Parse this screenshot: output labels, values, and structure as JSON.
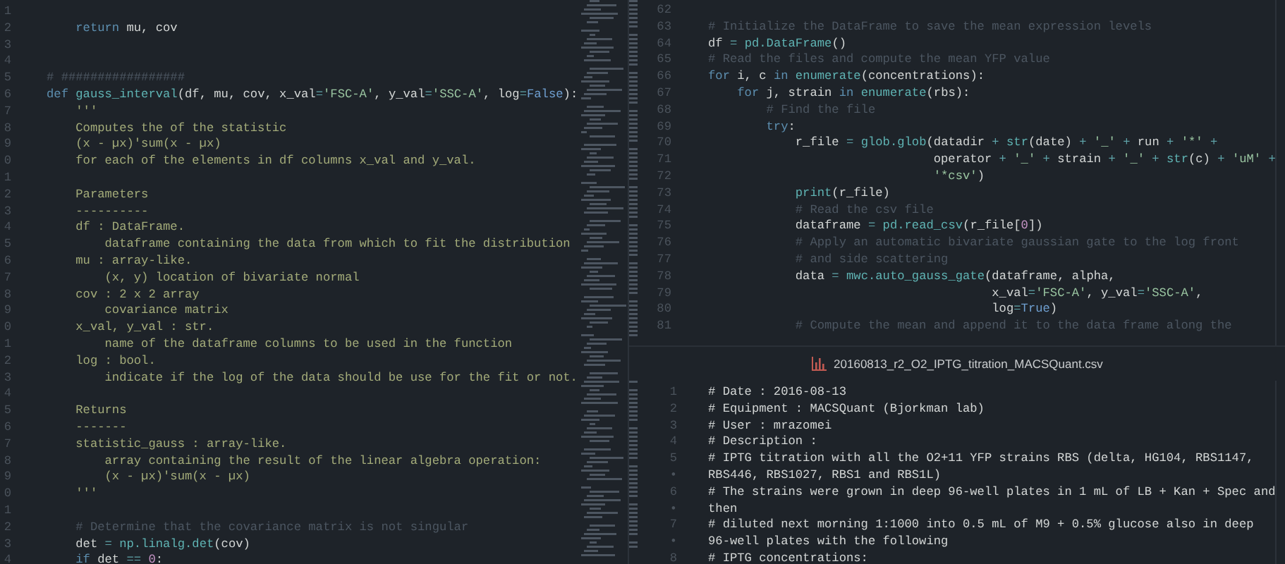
{
  "left_editor": {
    "lines": [
      {
        "number": "1"
      },
      {
        "number": "2",
        "tokens": [
          {
            "text": "    return",
            "kind": "keyword"
          },
          {
            "text": " mu, cov",
            "kind": "plain"
          }
        ]
      },
      {
        "number": "3"
      },
      {
        "number": "4"
      },
      {
        "number": "5",
        "tokens": [
          {
            "text": "# #################",
            "kind": "comment"
          }
        ]
      },
      {
        "number": "6",
        "tokens": [
          {
            "text": "def",
            "kind": "keyword"
          },
          {
            "text": " gauss_interval",
            "kind": "function"
          },
          {
            "text": "(df, mu, cov, x_val",
            "kind": "plain"
          },
          {
            "text": "=",
            "kind": "operator"
          },
          {
            "text": "'FSC-A'",
            "kind": "string"
          },
          {
            "text": ", y_val",
            "kind": "plain"
          },
          {
            "text": "=",
            "kind": "operator"
          },
          {
            "text": "'SSC-A'",
            "kind": "string"
          },
          {
            "text": ", log",
            "kind": "plain"
          },
          {
            "text": "=",
            "kind": "operator"
          },
          {
            "text": "False",
            "kind": "constant"
          },
          {
            "text": "):",
            "kind": "plain"
          }
        ]
      },
      {
        "number": "7",
        "tokens": [
          {
            "text": "    '''",
            "kind": "docstring"
          }
        ]
      },
      {
        "number": "8",
        "tokens": [
          {
            "text": "    Computes the of the statistic",
            "kind": "docstring"
          }
        ]
      },
      {
        "number": "9",
        "tokens": [
          {
            "text": "    (x - µx)'sum(x - µx)",
            "kind": "docstring"
          }
        ]
      },
      {
        "number": "0",
        "tokens": [
          {
            "text": "    for each of the elements in df columns x_val and y_val.",
            "kind": "docstring"
          }
        ]
      },
      {
        "number": "1"
      },
      {
        "number": "2",
        "tokens": [
          {
            "text": "    Parameters",
            "kind": "docstring"
          }
        ]
      },
      {
        "number": "3",
        "tokens": [
          {
            "text": "    ----------",
            "kind": "docstring"
          }
        ]
      },
      {
        "number": "4",
        "tokens": [
          {
            "text": "    df : DataFrame.",
            "kind": "docstring"
          }
        ]
      },
      {
        "number": "5",
        "tokens": [
          {
            "text": "        dataframe containing the data from which to fit the distribution",
            "kind": "docstring"
          }
        ]
      },
      {
        "number": "6",
        "tokens": [
          {
            "text": "    mu : array-like.",
            "kind": "docstring"
          }
        ]
      },
      {
        "number": "7",
        "tokens": [
          {
            "text": "        (x, y) location of bivariate normal",
            "kind": "docstring"
          }
        ]
      },
      {
        "number": "8",
        "tokens": [
          {
            "text": "    cov : 2 x 2 array",
            "kind": "docstring"
          }
        ]
      },
      {
        "number": "9",
        "tokens": [
          {
            "text": "        covariance matrix",
            "kind": "docstring"
          }
        ]
      },
      {
        "number": "0",
        "tokens": [
          {
            "text": "    x_val, y_val : str.",
            "kind": "docstring"
          }
        ]
      },
      {
        "number": "1",
        "tokens": [
          {
            "text": "        name of the dataframe columns to be used in the function",
            "kind": "docstring"
          }
        ]
      },
      {
        "number": "2",
        "tokens": [
          {
            "text": "    log : bool.",
            "kind": "docstring"
          }
        ]
      },
      {
        "number": "3",
        "tokens": [
          {
            "text": "        indicate if the log of the data should be use for the fit or not.",
            "kind": "docstring"
          }
        ]
      },
      {
        "number": "4"
      },
      {
        "number": "5",
        "tokens": [
          {
            "text": "    Returns",
            "kind": "docstring"
          }
        ]
      },
      {
        "number": "6",
        "tokens": [
          {
            "text": "    -------",
            "kind": "docstring"
          }
        ]
      },
      {
        "number": "7",
        "tokens": [
          {
            "text": "    statistic_gauss : array-like.",
            "kind": "docstring"
          }
        ]
      },
      {
        "number": "8",
        "tokens": [
          {
            "text": "        array containing the result of the linear algebra operation:",
            "kind": "docstring"
          }
        ]
      },
      {
        "number": "9",
        "tokens": [
          {
            "text": "        (x - µx)'sum(x - µx)",
            "kind": "docstring"
          }
        ]
      },
      {
        "number": "0",
        "tokens": [
          {
            "text": "    '''",
            "kind": "docstring"
          }
        ]
      },
      {
        "number": "1"
      },
      {
        "number": "2",
        "tokens": [
          {
            "text": "    # Determine that the covariance matrix is not singular",
            "kind": "comment"
          }
        ]
      },
      {
        "number": "3",
        "tokens": [
          {
            "text": "    det ",
            "kind": "plain"
          },
          {
            "text": "=",
            "kind": "operator"
          },
          {
            "text": " np.linalg.det",
            "kind": "function"
          },
          {
            "text": "(cov)",
            "kind": "plain"
          }
        ]
      },
      {
        "number": "4",
        "tokens": [
          {
            "text": "    if",
            "kind": "keyword"
          },
          {
            "text": " det ",
            "kind": "plain"
          },
          {
            "text": "==",
            "kind": "operator"
          },
          {
            "text": " 0",
            "kind": "number"
          },
          {
            "text": ":",
            "kind": "plain"
          }
        ]
      }
    ]
  },
  "right_editor": {
    "lines": [
      {
        "number": "62"
      },
      {
        "number": "63",
        "tokens": [
          {
            "text": "# Initialize the DataFrame to save the mean expression levels",
            "kind": "comment"
          }
        ]
      },
      {
        "number": "64",
        "tokens": [
          {
            "text": "df ",
            "kind": "plain"
          },
          {
            "text": "=",
            "kind": "operator"
          },
          {
            "text": " pd.DataFrame",
            "kind": "function"
          },
          {
            "text": "()",
            "kind": "plain"
          }
        ]
      },
      {
        "number": "65",
        "tokens": [
          {
            "text": "# Read the files and compute the mean YFP value",
            "kind": "comment"
          }
        ]
      },
      {
        "number": "66",
        "tokens": [
          {
            "text": "for",
            "kind": "keyword"
          },
          {
            "text": " i, c ",
            "kind": "plain"
          },
          {
            "text": "in",
            "kind": "keyword"
          },
          {
            "text": " enumerate",
            "kind": "function"
          },
          {
            "text": "(concentrations):",
            "kind": "plain"
          }
        ]
      },
      {
        "number": "67",
        "tokens": [
          {
            "text": "    for",
            "kind": "keyword"
          },
          {
            "text": " j, strain ",
            "kind": "plain"
          },
          {
            "text": "in",
            "kind": "keyword"
          },
          {
            "text": " enumerate",
            "kind": "function"
          },
          {
            "text": "(rbs):",
            "kind": "plain"
          }
        ]
      },
      {
        "number": "68",
        "tokens": [
          {
            "text": "        # Find the file",
            "kind": "comment"
          }
        ]
      },
      {
        "number": "69",
        "tokens": [
          {
            "text": "        try",
            "kind": "keyword"
          },
          {
            "text": ":",
            "kind": "plain"
          }
        ]
      },
      {
        "number": "70",
        "tokens": [
          {
            "text": "            r_file ",
            "kind": "plain"
          },
          {
            "text": "=",
            "kind": "operator"
          },
          {
            "text": " glob.glob",
            "kind": "function"
          },
          {
            "text": "(datadir ",
            "kind": "plain"
          },
          {
            "text": "+",
            "kind": "operator"
          },
          {
            "text": " str",
            "kind": "function"
          },
          {
            "text": "(date) ",
            "kind": "plain"
          },
          {
            "text": "+",
            "kind": "operator"
          },
          {
            "text": " '_' ",
            "kind": "string"
          },
          {
            "text": "+",
            "kind": "operator"
          },
          {
            "text": " run ",
            "kind": "plain"
          },
          {
            "text": "+",
            "kind": "operator"
          },
          {
            "text": " '*' ",
            "kind": "string"
          },
          {
            "text": "+",
            "kind": "operator"
          }
        ]
      },
      {
        "number": "71",
        "tokens": [
          {
            "text": "                               operator ",
            "kind": "plain"
          },
          {
            "text": "+",
            "kind": "operator"
          },
          {
            "text": " '_' ",
            "kind": "string"
          },
          {
            "text": "+",
            "kind": "operator"
          },
          {
            "text": " strain ",
            "kind": "plain"
          },
          {
            "text": "+",
            "kind": "operator"
          },
          {
            "text": " '_' ",
            "kind": "string"
          },
          {
            "text": "+",
            "kind": "operator"
          },
          {
            "text": " str",
            "kind": "function"
          },
          {
            "text": "(c) ",
            "kind": "plain"
          },
          {
            "text": "+",
            "kind": "operator"
          },
          {
            "text": " 'uM' ",
            "kind": "string"
          },
          {
            "text": "+",
            "kind": "operator"
          }
        ]
      },
      {
        "number": "72",
        "tokens": [
          {
            "text": "                               '*csv'",
            "kind": "string"
          },
          {
            "text": ")",
            "kind": "plain"
          }
        ]
      },
      {
        "number": "73",
        "tokens": [
          {
            "text": "            print",
            "kind": "function"
          },
          {
            "text": "(r_file)",
            "kind": "plain"
          }
        ]
      },
      {
        "number": "74",
        "tokens": [
          {
            "text": "            # Read the csv file",
            "kind": "comment"
          }
        ]
      },
      {
        "number": "75",
        "tokens": [
          {
            "text": "            dataframe ",
            "kind": "plain"
          },
          {
            "text": "=",
            "kind": "operator"
          },
          {
            "text": " pd.read_csv",
            "kind": "function"
          },
          {
            "text": "(r_file[",
            "kind": "plain"
          },
          {
            "text": "0",
            "kind": "number"
          },
          {
            "text": "])",
            "kind": "plain"
          }
        ]
      },
      {
        "number": "76",
        "tokens": [
          {
            "text": "            # Apply an automatic bivariate gaussian gate to the log front",
            "kind": "comment"
          }
        ]
      },
      {
        "number": "77",
        "tokens": [
          {
            "text": "            # and side scattering",
            "kind": "comment"
          }
        ]
      },
      {
        "number": "78",
        "tokens": [
          {
            "text": "            data ",
            "kind": "plain"
          },
          {
            "text": "=",
            "kind": "operator"
          },
          {
            "text": " mwc.auto_gauss_gate",
            "kind": "function"
          },
          {
            "text": "(dataframe, alpha,",
            "kind": "plain"
          }
        ]
      },
      {
        "number": "79",
        "tokens": [
          {
            "text": "                                       x_val",
            "kind": "plain"
          },
          {
            "text": "=",
            "kind": "operator"
          },
          {
            "text": "'FSC-A'",
            "kind": "string"
          },
          {
            "text": ", y_val",
            "kind": "plain"
          },
          {
            "text": "=",
            "kind": "operator"
          },
          {
            "text": "'SSC-A'",
            "kind": "string"
          },
          {
            "text": ",",
            "kind": "plain"
          }
        ]
      },
      {
        "number": "80",
        "tokens": [
          {
            "text": "                                       log",
            "kind": "plain"
          },
          {
            "text": "=",
            "kind": "operator"
          },
          {
            "text": "True",
            "kind": "constant"
          },
          {
            "text": ")",
            "kind": "plain"
          }
        ]
      },
      {
        "number": "81",
        "tokens": [
          {
            "text": "            # Compute the mean and append it to the data frame along the",
            "kind": "comment"
          }
        ]
      }
    ]
  },
  "csv_tab": {
    "title": "20160813_r2_O2_IPTG_titration_MACSQuant.csv"
  },
  "csv_editor": {
    "lines": [
      {
        "number": "1",
        "text": "# Date : 2016-08-13"
      },
      {
        "number": "2",
        "text": "# Equipment : MACSQuant (Bjorkman lab)"
      },
      {
        "number": "3",
        "text": "# User : mrazomei"
      },
      {
        "number": "4",
        "text": "# Description :"
      },
      {
        "number": "5",
        "text": "# IPTG titration with all the O2+11 YFP strains RBS (delta, HG104, RBS1147,"
      },
      {
        "number": "•",
        "text": "RBS446, RBS1027, RBS1 and RBS1L)"
      },
      {
        "number": "6",
        "text": "# The strains were grown in deep 96-well plates in 1 mL of LB + Kan + Spec and"
      },
      {
        "number": "•",
        "text": "then"
      },
      {
        "number": "7",
        "text": "# diluted next morning 1:1000 into 0.5 mL of M9 + 0.5% glucose also in deep"
      },
      {
        "number": "•",
        "text": "96-well plates with the following"
      },
      {
        "number": "8",
        "text": "# IPTG concentrations:"
      }
    ]
  }
}
